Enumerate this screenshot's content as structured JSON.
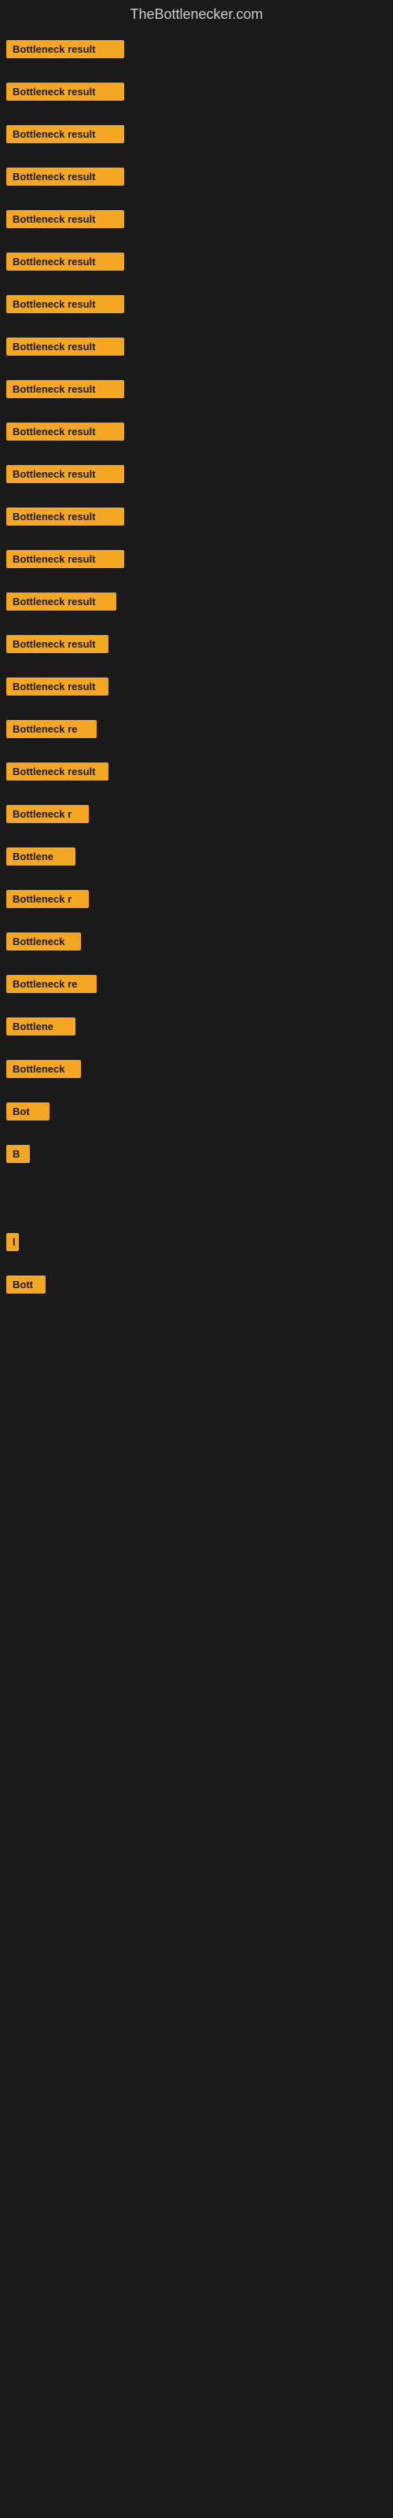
{
  "header": {
    "title": "TheBottlenecker.com"
  },
  "items": [
    {
      "label": "Bottleneck result",
      "width": 150
    },
    {
      "label": "Bottleneck result",
      "width": 150
    },
    {
      "label": "Bottleneck result",
      "width": 150
    },
    {
      "label": "Bottleneck result",
      "width": 150
    },
    {
      "label": "Bottleneck result",
      "width": 150
    },
    {
      "label": "Bottleneck result",
      "width": 150
    },
    {
      "label": "Bottleneck result",
      "width": 150
    },
    {
      "label": "Bottleneck result",
      "width": 150
    },
    {
      "label": "Bottleneck result",
      "width": 150
    },
    {
      "label": "Bottleneck result",
      "width": 150
    },
    {
      "label": "Bottleneck result",
      "width": 150
    },
    {
      "label": "Bottleneck result",
      "width": 150
    },
    {
      "label": "Bottleneck result",
      "width": 150
    },
    {
      "label": "Bottleneck result",
      "width": 140
    },
    {
      "label": "Bottleneck result",
      "width": 130
    },
    {
      "label": "Bottleneck result",
      "width": 130
    },
    {
      "label": "Bottleneck re",
      "width": 115
    },
    {
      "label": "Bottleneck result",
      "width": 130
    },
    {
      "label": "Bottleneck r",
      "width": 105
    },
    {
      "label": "Bottlene",
      "width": 88
    },
    {
      "label": "Bottleneck r",
      "width": 105
    },
    {
      "label": "Bottleneck",
      "width": 95
    },
    {
      "label": "Bottleneck re",
      "width": 115
    },
    {
      "label": "Bottlene",
      "width": 88
    },
    {
      "label": "Bottleneck",
      "width": 95
    },
    {
      "label": "Bot",
      "width": 55
    },
    {
      "label": "B",
      "width": 30
    },
    {
      "label": "",
      "width": 0
    },
    {
      "label": "l",
      "width": 16
    },
    {
      "label": "Bott",
      "width": 50
    },
    {
      "label": "",
      "width": 0
    },
    {
      "label": "",
      "width": 0
    },
    {
      "label": "",
      "width": 0
    },
    {
      "label": "",
      "width": 0
    },
    {
      "label": "",
      "width": 0
    },
    {
      "label": "",
      "width": 0
    }
  ]
}
